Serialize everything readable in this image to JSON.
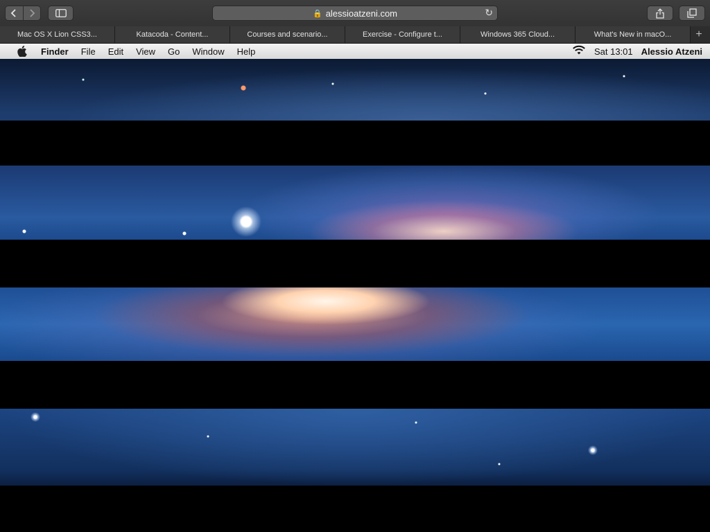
{
  "browser": {
    "url": "alessioatzeni.com",
    "tabs": [
      "Mac OS X Lion CSS3...",
      "Katacoda - Content...",
      "Courses and scenario...",
      "Exercise - Configure t...",
      "Windows 365 Cloud...",
      "What's New in macO..."
    ],
    "new_tab": "+"
  },
  "menubar": {
    "app": "Finder",
    "items": [
      "File",
      "Edit",
      "View",
      "Go",
      "Window",
      "Help"
    ],
    "clock": "Sat 13:01",
    "user": "Alessio Atzeni"
  }
}
